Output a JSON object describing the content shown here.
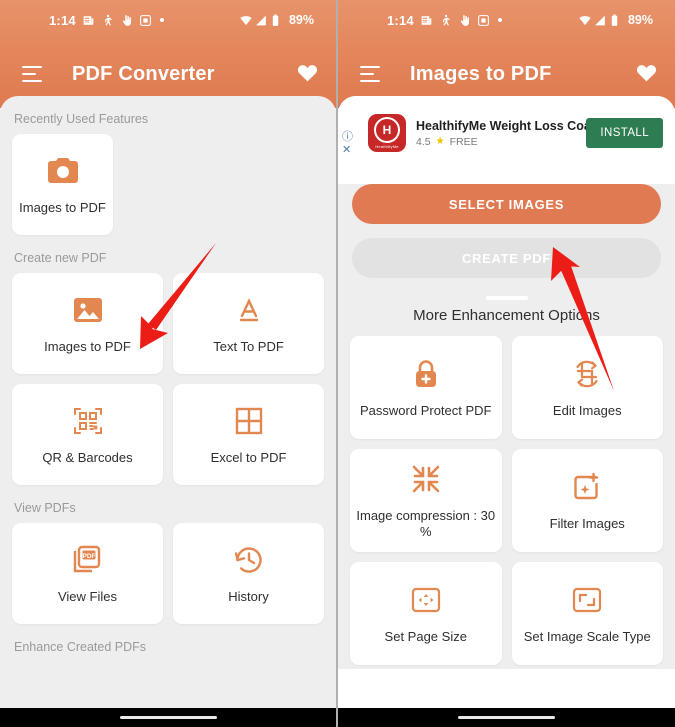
{
  "status_bar": {
    "time": "1:14",
    "left_icons": [
      "news-icon",
      "person-walking-icon",
      "hand-icon",
      "screenshot-icon",
      "dot-icon"
    ],
    "right_icons": [
      "wifi-icon",
      "signal-icon",
      "battery-icon"
    ],
    "battery": "89%"
  },
  "colors": {
    "header_top": "#e8936a",
    "header_bottom": "#de7a4e",
    "accent": "#e08050",
    "primary_button": "#e07a52",
    "install_button": "#2e7d52",
    "arrow": "#ec1c16",
    "page_bg": "#eeeeee",
    "card_bg": "#ffffff",
    "label_text": "#9a9a9a"
  },
  "left_screen": {
    "appbar": {
      "menu_label": "menu",
      "title": "PDF Converter",
      "favorite_label": "favorite"
    },
    "sections": [
      {
        "label": "Recently Used Features",
        "layout": "single",
        "items": [
          {
            "label": "Images to PDF",
            "icon": "camera-icon"
          }
        ]
      },
      {
        "label": "Create new PDF",
        "layout": "grid",
        "items": [
          {
            "label": "Images to PDF",
            "icon": "image-icon"
          },
          {
            "label": "Text To PDF",
            "icon": "text-a-icon"
          },
          {
            "label": "QR & Barcodes",
            "icon": "qr-code-icon"
          },
          {
            "label": "Excel to PDF",
            "icon": "table-grid-icon"
          }
        ]
      },
      {
        "label": "View PDFs",
        "layout": "grid",
        "items": [
          {
            "label": "View Files",
            "icon": "pdf-files-icon"
          },
          {
            "label": "History",
            "icon": "history-clock-icon"
          }
        ]
      },
      {
        "label": "Enhance Created PDFs",
        "layout": "grid",
        "items": []
      }
    ]
  },
  "right_screen": {
    "appbar": {
      "menu_label": "menu",
      "title": "Images to PDF",
      "favorite_label": "favorite"
    },
    "ad": {
      "app_icon": "healthifyme-logo-icon",
      "app_icon_mark": "H",
      "app_icon_brand": "HealthifyMe",
      "title": "HealthifyMe Weight Loss Coach",
      "rating": "4.5",
      "star": "star-icon",
      "price": "FREE",
      "install_label": "INSTALL",
      "info_icon": "info-icon",
      "close_icon": "close-icon"
    },
    "actions": {
      "select_images": "SELECT IMAGES",
      "create_pdf": "CREATE PDF"
    },
    "more_options_title": "More Enhancement Options",
    "options": [
      {
        "label": "Password Protect PDF",
        "icon": "lock-plus-icon"
      },
      {
        "label": "Edit Images",
        "icon": "crop-rotate-icon"
      },
      {
        "label": "Image compression : 30 %",
        "icon": "compress-arrows-icon"
      },
      {
        "label": "Filter Images",
        "icon": "filter-sparkle-icon"
      },
      {
        "label": "Set Page Size",
        "icon": "page-size-arrows-icon"
      },
      {
        "label": "Set Image Scale Type",
        "icon": "scale-corners-icon"
      }
    ]
  },
  "annotations": {
    "left_arrow": "arrow pointing down-left to Images to PDF card",
    "right_arrow": "arrow pointing up-left to SELECT IMAGES button"
  }
}
